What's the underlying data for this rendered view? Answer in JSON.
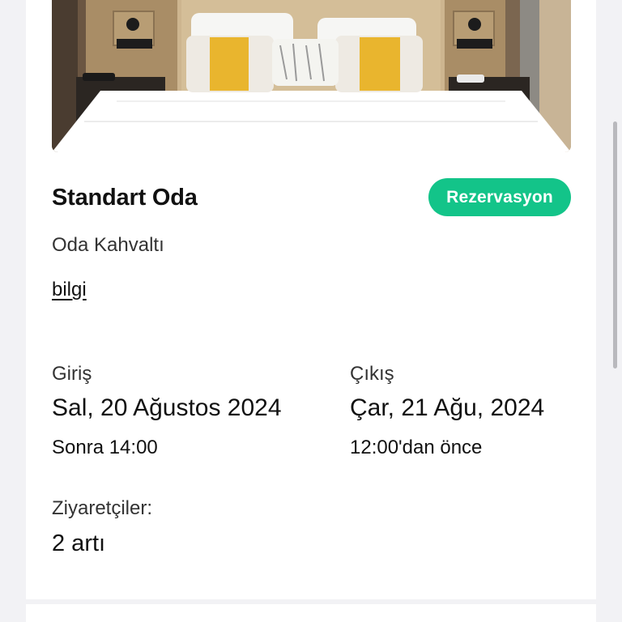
{
  "room": {
    "name": "Standart Oda",
    "board": "Oda Kahvaltı",
    "info_link": "bilgi",
    "reserve_label": "Rezervasyon"
  },
  "checkin": {
    "label": "Giriş",
    "date": "Sal, 20 Ağustos 2024",
    "time": "Sonra 14:00"
  },
  "checkout": {
    "label": "Çıkış",
    "date": "Çar, 21 Ağu, 2024",
    "time": "12:00'dan önce"
  },
  "guests": {
    "label": "Ziyaretçiler:",
    "value": "2 artı"
  },
  "colors": {
    "accent": "#13c489",
    "background": "#f2f2f5",
    "card": "#ffffff"
  }
}
